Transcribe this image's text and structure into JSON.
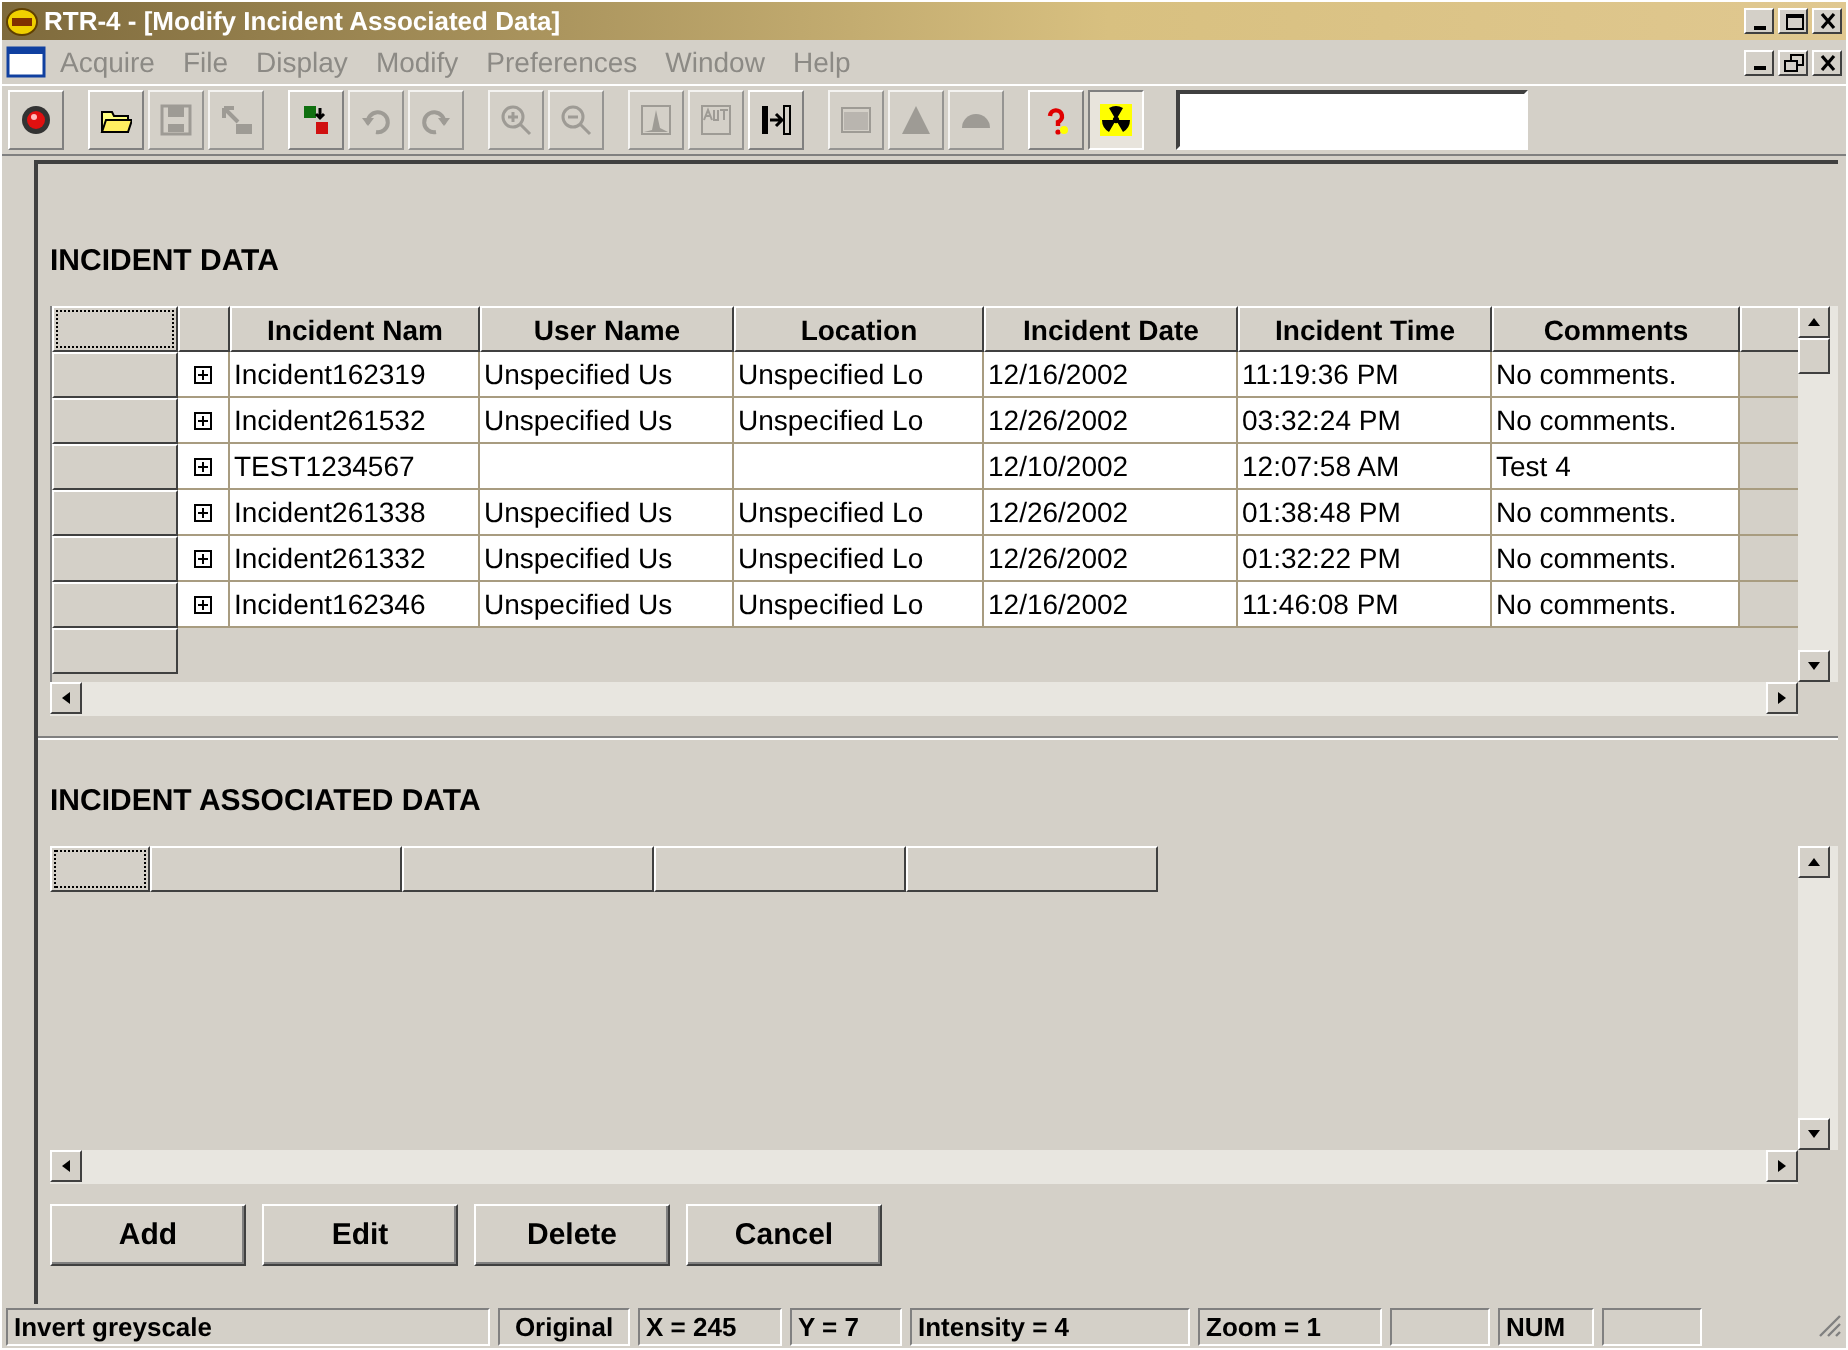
{
  "window": {
    "title": "RTR-4 - [Modify Incident Associated Data]"
  },
  "menu": [
    {
      "label": "Acquire",
      "disabled": true
    },
    {
      "label": "File",
      "disabled": true
    },
    {
      "label": "Display",
      "disabled": true
    },
    {
      "label": "Modify",
      "disabled": true
    },
    {
      "label": "Preferences",
      "disabled": true
    },
    {
      "label": "Window",
      "disabled": true
    },
    {
      "label": "Help",
      "disabled": true
    }
  ],
  "toolbar": [
    {
      "kind": "record",
      "disabled": false
    },
    {
      "kind": "sep"
    },
    {
      "kind": "open",
      "disabled": false
    },
    {
      "kind": "save",
      "disabled": true
    },
    {
      "kind": "export",
      "disabled": true
    },
    {
      "kind": "sep"
    },
    {
      "kind": "transfer",
      "disabled": false
    },
    {
      "kind": "undo",
      "disabled": true
    },
    {
      "kind": "redo",
      "disabled": true
    },
    {
      "kind": "sep"
    },
    {
      "kind": "zoomin",
      "disabled": true
    },
    {
      "kind": "zoomout",
      "disabled": true
    },
    {
      "kind": "sep"
    },
    {
      "kind": "histogram",
      "disabled": true
    },
    {
      "kind": "auto",
      "disabled": true
    },
    {
      "kind": "split",
      "disabled": false
    },
    {
      "kind": "sep"
    },
    {
      "kind": "panel",
      "disabled": true
    },
    {
      "kind": "triangle",
      "disabled": true
    },
    {
      "kind": "dome",
      "disabled": true
    },
    {
      "kind": "sep"
    },
    {
      "kind": "help",
      "disabled": false
    },
    {
      "kind": "radiation",
      "disabled": false
    }
  ],
  "incident_data": {
    "heading": "INCIDENT DATA",
    "columns": [
      "Incident Nam",
      "User Name",
      "Location",
      "Incident Date",
      "Incident Time",
      "Comments"
    ],
    "rows": [
      [
        "Incident162319",
        "Unspecified Us",
        "Unspecified Lo",
        "12/16/2002",
        "11:19:36 PM",
        "No comments."
      ],
      [
        "Incident261532",
        "Unspecified Us",
        "Unspecified Lo",
        "12/26/2002",
        "03:32:24 PM",
        "No comments."
      ],
      [
        "TEST1234567",
        null,
        null,
        "12/10/2002",
        "12:07:58 AM",
        "Test 4"
      ],
      [
        "Incident261338",
        "Unspecified Us",
        "Unspecified Lo",
        "12/26/2002",
        "01:38:48 PM",
        "No comments."
      ],
      [
        "Incident261332",
        "Unspecified Us",
        "Unspecified Lo",
        "12/26/2002",
        "01:32:22 PM",
        "No comments."
      ],
      [
        "Incident162346",
        "Unspecified Us",
        "Unspecified Lo",
        "12/16/2002",
        "11:46:08 PM",
        "No comments."
      ]
    ]
  },
  "associated_data": {
    "heading": "INCIDENT ASSOCIATED DATA"
  },
  "buttons": [
    "Add",
    "Edit",
    "Delete",
    "Cancel"
  ],
  "status_bar": [
    {
      "kind": "text",
      "text": "Invert greyscale"
    },
    {
      "kind": "text",
      "text": "Original"
    },
    {
      "kind": "text",
      "text": "X = 245"
    },
    {
      "kind": "text",
      "text": "Y = 7"
    },
    {
      "kind": "text",
      "text": "Intensity = 4"
    },
    {
      "kind": "text",
      "text": "Zoom = 1"
    },
    {
      "kind": "blank"
    },
    {
      "kind": "text",
      "text": "NUM"
    },
    {
      "kind": "blank"
    }
  ]
}
